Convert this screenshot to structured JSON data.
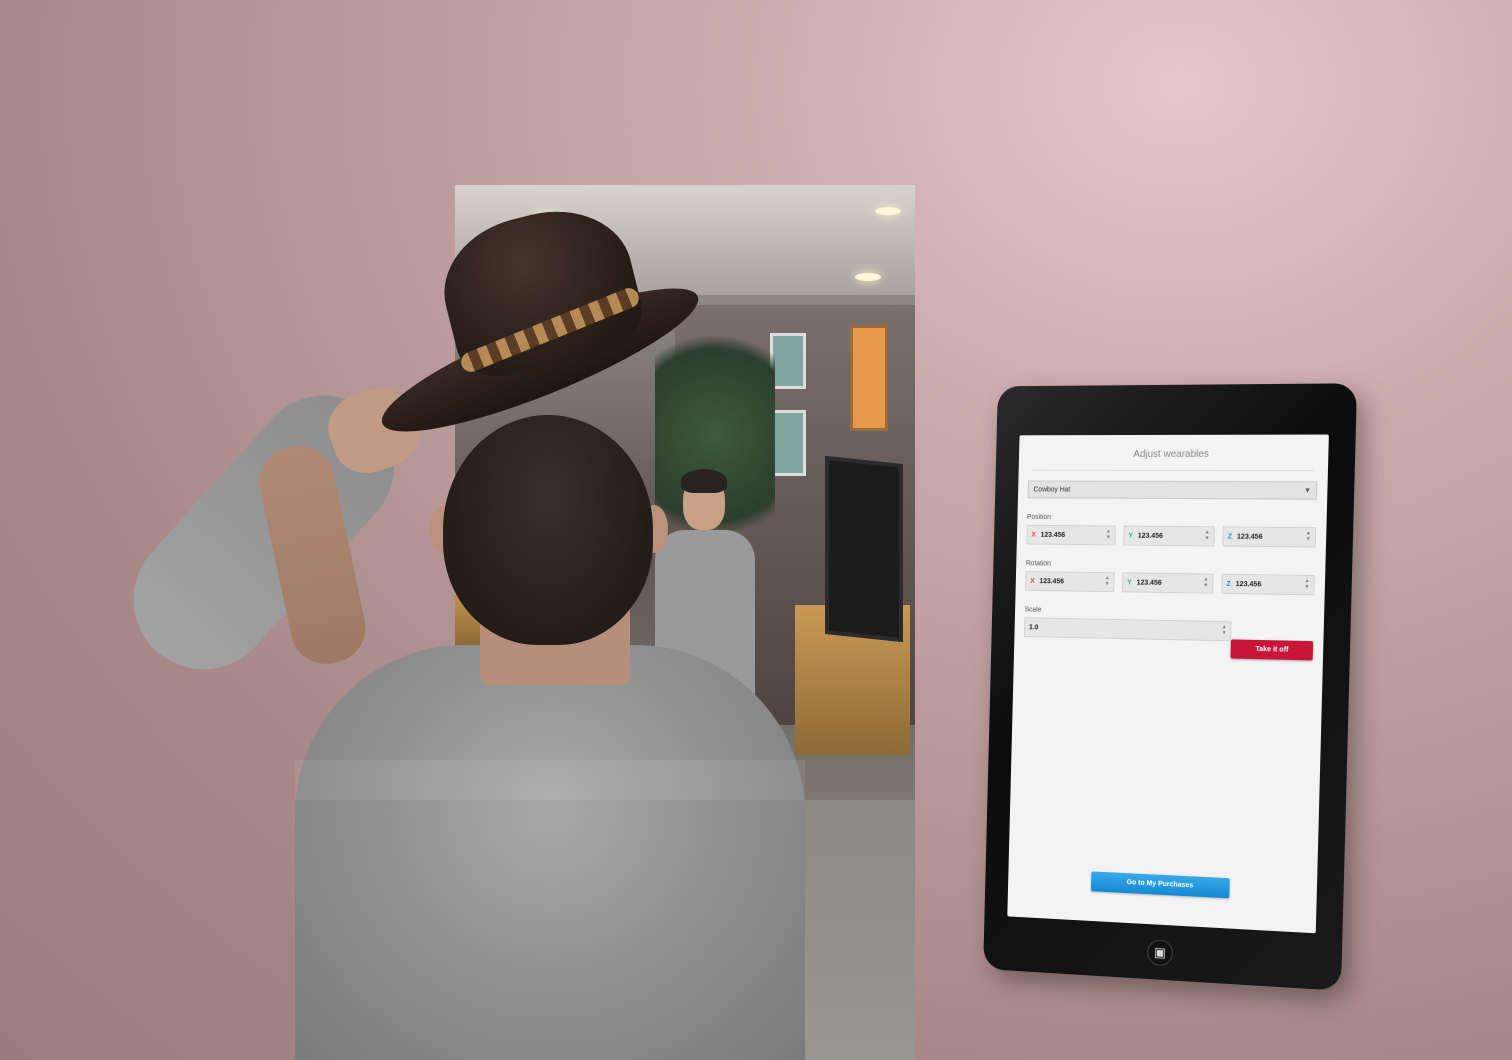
{
  "tablet": {
    "title": "Adjust wearables",
    "wearable_select": {
      "value": "Cowboy Hat"
    },
    "position": {
      "label": "Position",
      "x": {
        "axis": "X",
        "value": "123.456"
      },
      "y": {
        "axis": "Y",
        "value": "123.456"
      },
      "z": {
        "axis": "Z",
        "value": "123.456"
      }
    },
    "rotation": {
      "label": "Rotation",
      "x": {
        "axis": "X",
        "value": "123.456"
      },
      "y": {
        "axis": "Y",
        "value": "123.456"
      },
      "z": {
        "axis": "Z",
        "value": "123.456"
      }
    },
    "scale": {
      "label": "Scale",
      "value": "1.0"
    },
    "take_off_label": "Take it off",
    "go_to_purchases_label": "Go to My Purchases",
    "home_icon": "logo-icon"
  },
  "colors": {
    "take_off_button": "#c8153a",
    "purchases_button": "#1488d3",
    "axis_x": "#e24a4a",
    "axis_y": "#3bb36a",
    "axis_z": "#2f8ad6"
  }
}
